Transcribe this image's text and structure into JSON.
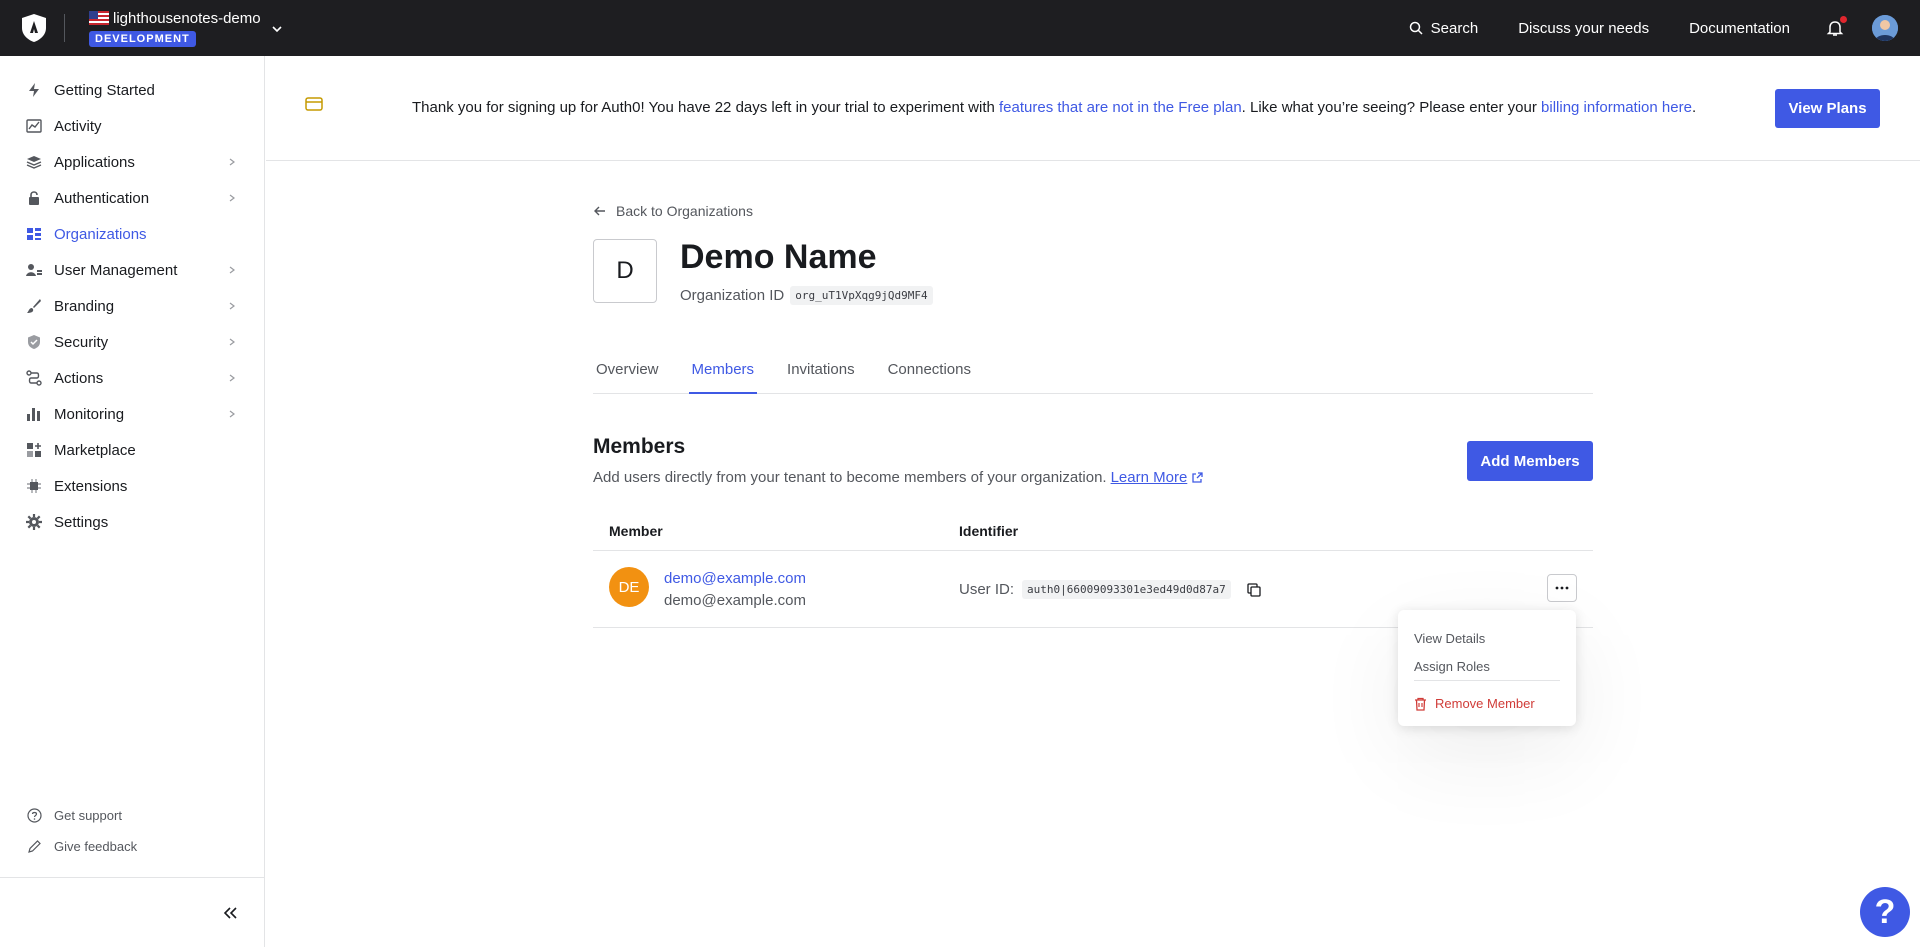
{
  "topbar": {
    "tenant_name": "lighthousenotes-demo",
    "env_badge": "DEVELOPMENT",
    "search_label": "Search",
    "discuss_label": "Discuss your needs",
    "docs_label": "Documentation"
  },
  "sidebar": {
    "items": [
      {
        "label": "Getting Started"
      },
      {
        "label": "Activity"
      },
      {
        "label": "Applications"
      },
      {
        "label": "Authentication"
      },
      {
        "label": "Organizations"
      },
      {
        "label": "User Management"
      },
      {
        "label": "Branding"
      },
      {
        "label": "Security"
      },
      {
        "label": "Actions"
      },
      {
        "label": "Monitoring"
      },
      {
        "label": "Marketplace"
      },
      {
        "label": "Extensions"
      },
      {
        "label": "Settings"
      }
    ],
    "footer": {
      "support": "Get support",
      "feedback": "Give feedback"
    }
  },
  "banner": {
    "text_1": "Thank you for signing up for Auth0! You have 22 days left in your trial to experiment with ",
    "link_1": "features that are not in the Free plan",
    "text_2": ". Like what you’re seeing? Please enter your ",
    "link_2": "billing information here",
    "text_3": ".",
    "button": "View Plans"
  },
  "org": {
    "back_label": "Back to Organizations",
    "logo_letter": "D",
    "name": "Demo Name",
    "id_label": "Organization ID",
    "id_value": "org_uT1VpXqg9jQd9MF4"
  },
  "tabs": [
    "Overview",
    "Members",
    "Invitations",
    "Connections"
  ],
  "members": {
    "title": "Members",
    "description": "Add users directly from your tenant to become members of your organization.",
    "learn_more": "Learn More",
    "add_button": "Add Members",
    "columns": {
      "member": "Member",
      "identifier": "Identifier"
    },
    "rows": [
      {
        "initials": "DE",
        "name": "demo@example.com",
        "email": "demo@example.com",
        "user_id_label": "User ID:",
        "user_id": "auth0|66009093301e3ed49d0d87a7"
      }
    ]
  },
  "row_menu": {
    "view_details": "View Details",
    "assign_roles": "Assign Roles",
    "remove_member": "Remove Member"
  },
  "help": {
    "label": "?"
  },
  "colors": {
    "accent": "#3f59e4",
    "topbar": "#1e1e21",
    "danger": "#d03c38",
    "avatar": "#f29111"
  }
}
